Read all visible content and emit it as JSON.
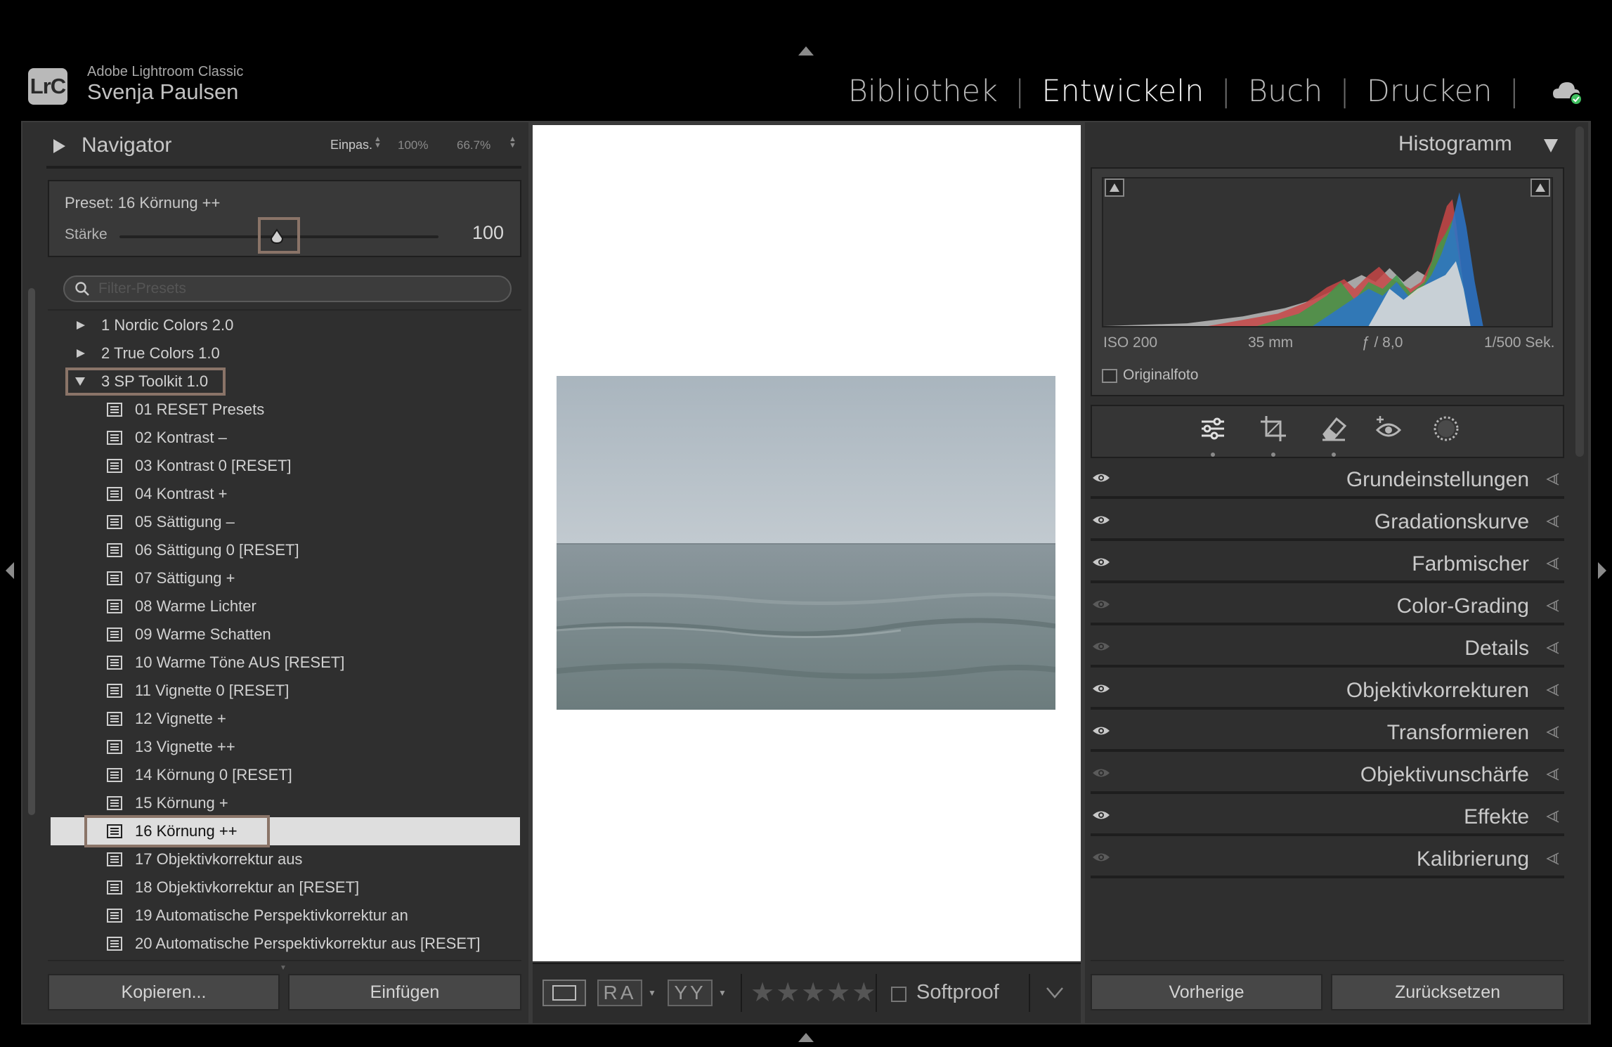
{
  "app": {
    "logo": "LrC",
    "name": "Adobe Lightroom Classic",
    "user": "Svenja Paulsen"
  },
  "modules": [
    {
      "label": "Bibliothek",
      "active": false
    },
    {
      "label": "Entwickeln",
      "active": true
    },
    {
      "label": "Buch",
      "active": false
    },
    {
      "label": "Drucken",
      "active": false
    }
  ],
  "module_separator": "|",
  "navigator": {
    "title": "Navigator",
    "zoom_fit": "Einpas.",
    "zoom_100": "100%",
    "zoom_custom": "66.7%"
  },
  "preset_amount": {
    "preset_label": "Preset: 16  Körnung ++",
    "strength_label": "Stärke",
    "strength_value": "100",
    "strength_fraction": 0.5
  },
  "search": {
    "placeholder": "Filter-Presets"
  },
  "preset_groups": [
    {
      "label": "1  Nordic Colors 2.0",
      "expanded": false
    },
    {
      "label": "2  True Colors 1.0",
      "expanded": false
    },
    {
      "label": "3  SP Toolkit 1.0",
      "expanded": true
    }
  ],
  "presets": [
    "01  RESET Presets",
    "02  Kontrast –",
    "03  Kontrast 0 [RESET]",
    "04  Kontrast +",
    "05  Sättigung –",
    "06  Sättigung 0 [RESET]",
    "07  Sättigung +",
    "08  Warme Lichter",
    "09  Warme Schatten",
    "10  Warme Töne AUS [RESET]",
    "11  Vignette 0 [RESET]",
    "12  Vignette +",
    "13  Vignette ++",
    "14  Körnung 0 [RESET]",
    "15  Körnung +",
    "16  Körnung ++",
    "17  Objektivkorrektur aus",
    "18  Objektivkorrektur an [RESET]",
    "19  Automatische Perspektivkorrektur an",
    "20  Automatische Perspektivkorrektur aus [RESET]"
  ],
  "selected_preset_index": 15,
  "left_buttons": {
    "copy": "Kopieren...",
    "paste": "Einfügen"
  },
  "toolbar": {
    "ra": "RA",
    "yy": "YY",
    "stars": "★★★★★",
    "softproof": "Softproof"
  },
  "histogram": {
    "title": "Histogramm",
    "iso": "ISO 200",
    "focal": "35 mm",
    "aperture": "ƒ / 8,0",
    "shutter": "1/500 Sek.",
    "original_label": "Originalfoto"
  },
  "tools": [
    "sliders-icon",
    "crop-icon",
    "eraser-icon",
    "red-eye-icon",
    "mask-icon"
  ],
  "sections": [
    {
      "label": "Grundeinstellungen",
      "enabled": true
    },
    {
      "label": "Gradationskurve",
      "enabled": true
    },
    {
      "label": "Farbmischer",
      "enabled": true
    },
    {
      "label": "Color-Grading",
      "enabled": false
    },
    {
      "label": "Details",
      "enabled": false
    },
    {
      "label": "Objektivkorrekturen",
      "enabled": true
    },
    {
      "label": "Transformieren",
      "enabled": true
    },
    {
      "label": "Objektivunschärfe",
      "enabled": false
    },
    {
      "label": "Effekte",
      "enabled": true
    },
    {
      "label": "Kalibrierung",
      "enabled": false
    }
  ],
  "right_buttons": {
    "previous": "Vorherige",
    "reset": "Zurücksetzen"
  },
  "colors": {
    "accent_highlight": "#8a7468",
    "selected_row": "#dedede",
    "cloud_sync": "#3fbf5f"
  }
}
